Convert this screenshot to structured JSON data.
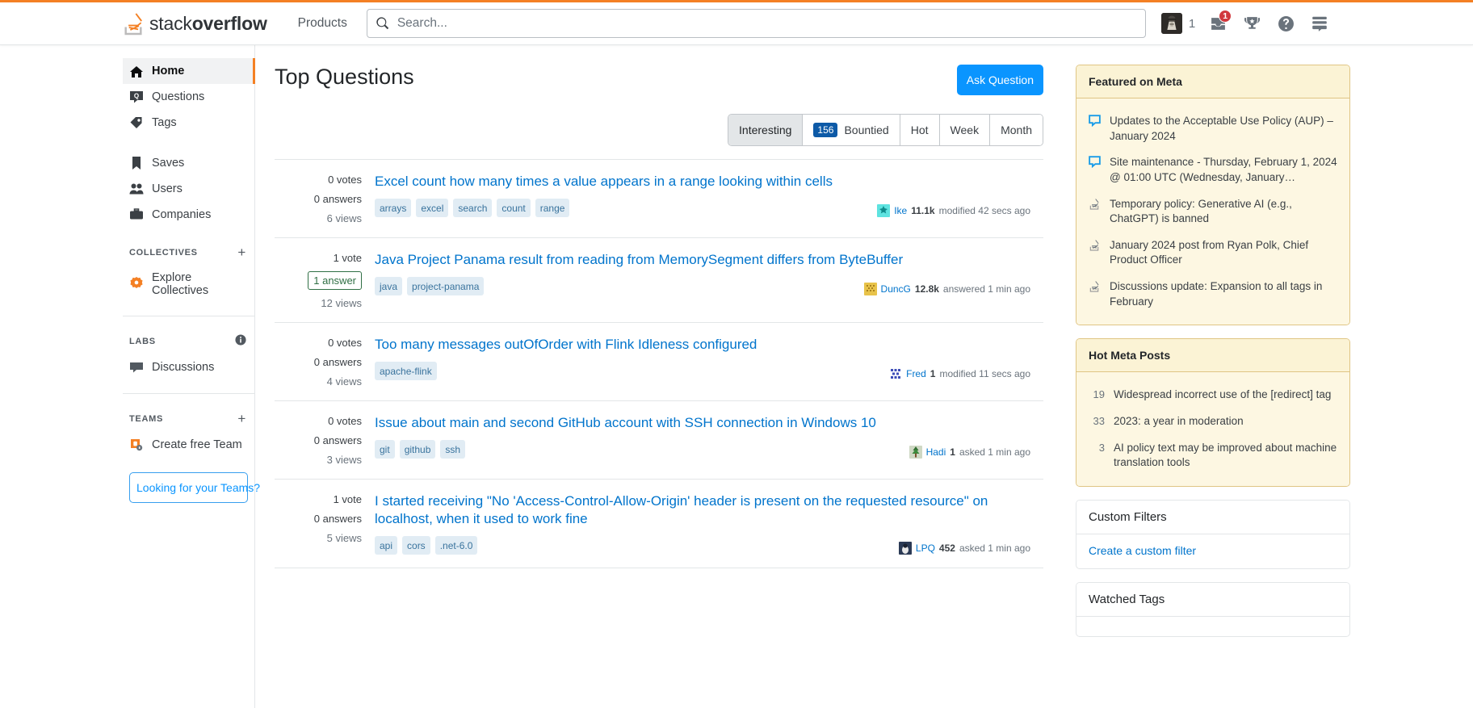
{
  "header": {
    "logo_text_light": "stack",
    "logo_text_bold": "overflow",
    "products_label": "Products",
    "search_placeholder": "Search...",
    "search_value": "",
    "avatar_rep": "1",
    "inbox_badge": "1",
    "icons": {
      "search": "search-icon",
      "avatar": "user-avatar",
      "inbox": "inbox-icon",
      "achievements": "trophy-icon",
      "help": "help-circle-icon",
      "stacks": "stacks-menu-icon"
    }
  },
  "sidebar": {
    "primary": [
      {
        "label": "Home",
        "icon": "home-icon",
        "active": true
      },
      {
        "label": "Questions",
        "icon": "question-bubble-icon",
        "active": false
      },
      {
        "label": "Tags",
        "icon": "tag-icon",
        "active": false
      }
    ],
    "secondary": [
      {
        "label": "Saves",
        "icon": "bookmark-icon"
      },
      {
        "label": "Users",
        "icon": "users-icon"
      },
      {
        "label": "Companies",
        "icon": "briefcase-icon"
      }
    ],
    "collectives": {
      "heading": "COLLECTIVES",
      "add_label": "+",
      "items": [
        {
          "label": "Explore Collectives",
          "icon": "collectives-star-icon"
        }
      ]
    },
    "labs": {
      "heading": "LABS",
      "info_label": "i",
      "items": [
        {
          "label": "Discussions",
          "icon": "discussion-bubble-icon"
        }
      ]
    },
    "teams": {
      "heading": "TEAMS",
      "add_label": "+",
      "items": [
        {
          "label": "Create free Team",
          "icon": "teams-lock-icon"
        }
      ],
      "button_label": "Looking for your Teams?"
    }
  },
  "main": {
    "title": "Top Questions",
    "ask_button": "Ask Question",
    "tabs": [
      {
        "label": "Interesting",
        "badge": null,
        "active": true
      },
      {
        "label": "Bountied",
        "badge": "156",
        "active": false
      },
      {
        "label": "Hot",
        "badge": null,
        "active": false
      },
      {
        "label": "Week",
        "badge": null,
        "active": false
      },
      {
        "label": "Month",
        "badge": null,
        "active": false
      }
    ],
    "questions": [
      {
        "votes": "0 votes",
        "answers": "0 answers",
        "answers_accepted": false,
        "views": "6 views",
        "title": "Excel count how many times a value appears in a range looking within cells",
        "tags": [
          "arrays",
          "excel",
          "search",
          "count",
          "range"
        ],
        "user": "Ike",
        "rep": "11.1k",
        "action": "modified 42 secs ago",
        "avatar_color": "#5ee3e0"
      },
      {
        "votes": "1 vote",
        "answers": "1 answer",
        "answers_accepted": true,
        "views": "12 views",
        "title": "Java Project Panama result from reading from MemorySegment differs from ByteBuffer",
        "tags": [
          "java",
          "project-panama"
        ],
        "user": "DuncG",
        "rep": "12.8k",
        "action": "answered 1 min ago",
        "avatar_color": "#e8c34a"
      },
      {
        "votes": "0 votes",
        "answers": "0 answers",
        "answers_accepted": false,
        "views": "4 views",
        "title": "Too many messages outOfOrder with Flink Idleness configured",
        "tags": [
          "apache-flink"
        ],
        "user": "Fred",
        "rep": "1",
        "action": "modified 11 secs ago",
        "avatar_color": "#3d4db7"
      },
      {
        "votes": "0 votes",
        "answers": "0 answers",
        "answers_accepted": false,
        "views": "3 views",
        "title": "Issue about main and second GitHub account with SSH connection in Windows 10",
        "tags": [
          "git",
          "github",
          "ssh"
        ],
        "user": "Hadi",
        "rep": "1",
        "action": "asked 1 min ago",
        "avatar_color": "#3c7a3c"
      },
      {
        "votes": "1 vote",
        "answers": "0 answers",
        "answers_accepted": false,
        "views": "5 views",
        "title": "I started receiving \"No 'Access-Control-Allow-Origin' header is present on the requested resource\" on localhost, when it used to work fine",
        "tags": [
          "api",
          "cors",
          ".net-6.0"
        ],
        "user": "LPQ",
        "rep": "452",
        "action": "asked 1 min ago",
        "avatar_color": "#2b3a55"
      }
    ]
  },
  "rightbar": {
    "featured_on_meta": {
      "heading": "Featured on Meta",
      "items": [
        {
          "text": "Updates to the Acceptable Use Policy (AUP) – January 2024",
          "icon": "speech-bubble-icon"
        },
        {
          "text": "Site maintenance - Thursday, February 1, 2024 @ 01:00 UTC (Wednesday, January…",
          "icon": "speech-bubble-icon"
        },
        {
          "text": "Temporary policy: Generative AI (e.g., ChatGPT) is banned",
          "icon": "stackoverflow-logo-icon"
        },
        {
          "text": "January 2024 post from Ryan Polk, Chief Product Officer",
          "icon": "stackoverflow-logo-icon"
        },
        {
          "text": "Discussions update: Expansion to all tags in February",
          "icon": "stackoverflow-logo-icon"
        }
      ]
    },
    "hot_meta_posts": {
      "heading": "Hot Meta Posts",
      "items": [
        {
          "score": "19",
          "text": "Widespread incorrect use of the [redirect] tag"
        },
        {
          "score": "33",
          "text": "2023: a year in moderation"
        },
        {
          "score": "3",
          "text": "AI policy text may be improved about machine translation tools"
        }
      ]
    },
    "custom_filters": {
      "heading": "Custom Filters",
      "link": "Create a custom filter"
    },
    "watched_tags": {
      "heading": "Watched Tags"
    }
  },
  "colors": {
    "orange": "#f48024",
    "blue": "#0a95ff",
    "link_blue": "#0074cc",
    "tag_bg": "#e1ecf4",
    "tag_fg": "#39739d",
    "meta_bg": "#fdf7e2",
    "meta_border": "#e0c584",
    "badge_red": "#d1383d",
    "badge_blue": "#0d5aa7",
    "green": "#2f6f44"
  }
}
